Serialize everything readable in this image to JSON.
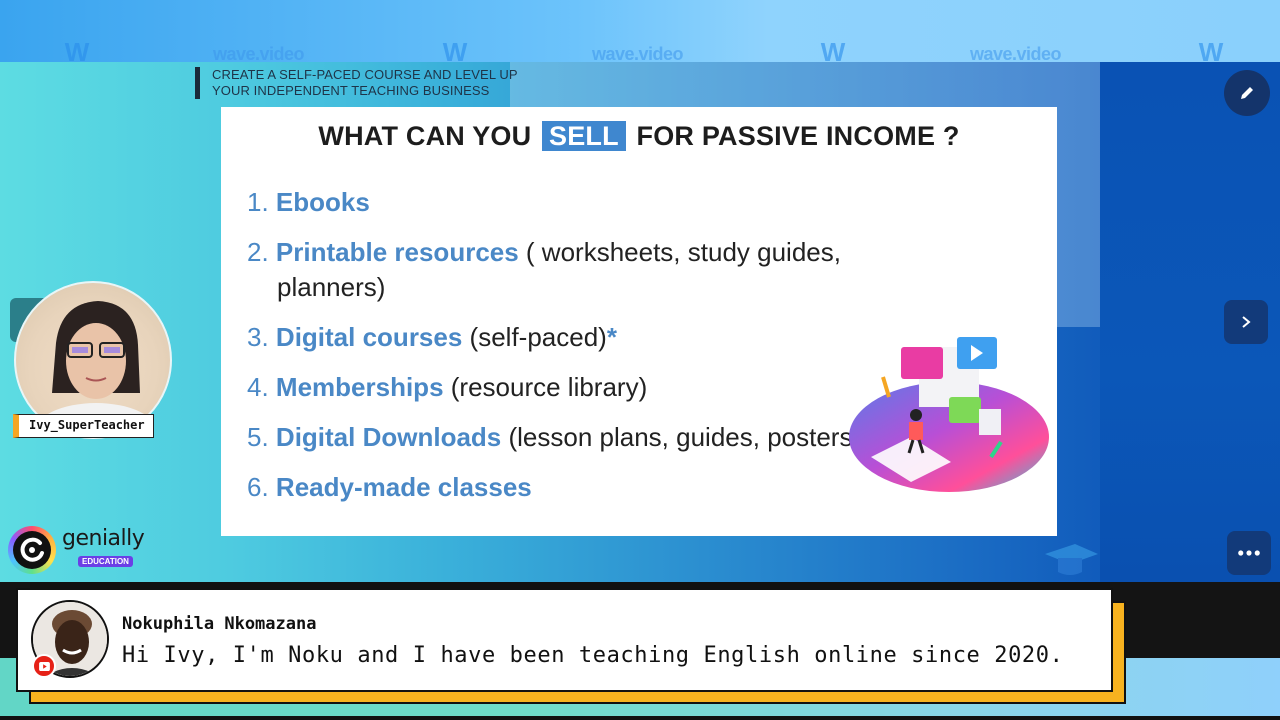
{
  "watermark": {
    "brand": "wave.video",
    "colors": {
      "banner_left": "#3aa4ef",
      "banner_right": "#8fd3fd"
    }
  },
  "course_title": {
    "line1": "CREATE A SELF-PACED COURSE AND LEVEL UP",
    "line2": "YOUR INDEPENDENT TEACHING BUSINESS"
  },
  "slide": {
    "heading_before": "WHAT CAN YOU",
    "heading_highlight": "SELL",
    "heading_after": "FOR PASSIVE INCOME ?",
    "accent_color": "#4a88c6",
    "items": [
      {
        "num": "1.",
        "term": "Ebooks",
        "note": "",
        "marker": ""
      },
      {
        "num": "2.",
        "term": "Printable resources",
        "note": " ( worksheets, study guides, planners)",
        "marker": ""
      },
      {
        "num": "3.",
        "term": "Digital courses",
        "note": " (self-paced)",
        "marker": "*"
      },
      {
        "num": "4.",
        "term": "Memberships",
        "note": " (resource library)",
        "marker": ""
      },
      {
        "num": "5.",
        "term": "Digital Downloads",
        "note": " (lesson plans, guides, posters)",
        "marker": ""
      },
      {
        "num": "6.",
        "term": "Ready-made classes",
        "note": "",
        "marker": ""
      }
    ],
    "illustration": "online-learning-illustration"
  },
  "presenter": {
    "name": "Ivy_SuperTeacher",
    "name_accent": "#f5a623"
  },
  "brand_logo": {
    "name": "genially",
    "badge": "EDUCATION"
  },
  "controls": {
    "edit_icon": "pencil-icon",
    "next_icon": "chevron-right-icon",
    "more_icon": "more-horizontal-icon"
  },
  "comment": {
    "author": "Nokuphila Nkomazana",
    "text": "Hi Ivy, I'm Noku and I have been teaching English online since 2020.",
    "platform_icon": "youtube-icon",
    "shadow_color": "#f7b21f"
  }
}
